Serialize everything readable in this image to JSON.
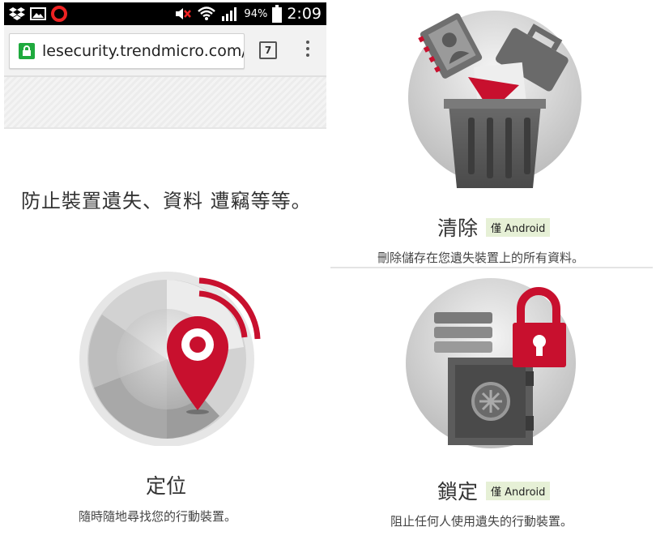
{
  "status_bar": {
    "battery_percent": "94%",
    "time": "2:09",
    "icons": [
      "dropbox-icon",
      "gallery-icon",
      "opera-icon",
      "muted-speaker-icon",
      "wifi-icon",
      "signal-icon",
      "battery-icon"
    ]
  },
  "browser": {
    "url": "lesecurity.trendmicro.com/l",
    "tab_count": "7",
    "icons": [
      "lock-icon",
      "overflow-menu-icon"
    ]
  },
  "page": {
    "headline": "防止裝置遺失、資料 遭竊等等。",
    "features": [
      {
        "title": "清除",
        "badge": "僅 Android",
        "description": "刪除儲存在您遺失裝置上的所有資料。",
        "icon": "wipe-trash-icon"
      },
      {
        "title": "定位",
        "badge": "",
        "description": "隨時隨地尋找您的行動裝置。",
        "icon": "locate-pin-icon"
      },
      {
        "title": "鎖定",
        "badge": "僅 Android",
        "description": "阻止任何人使用遺失的行動裝置。",
        "icon": "lock-safe-icon"
      }
    ]
  },
  "colors": {
    "accent_red": "#c8102e",
    "secure_green": "#1faa3e",
    "badge_bg": "#e6f0d6"
  }
}
